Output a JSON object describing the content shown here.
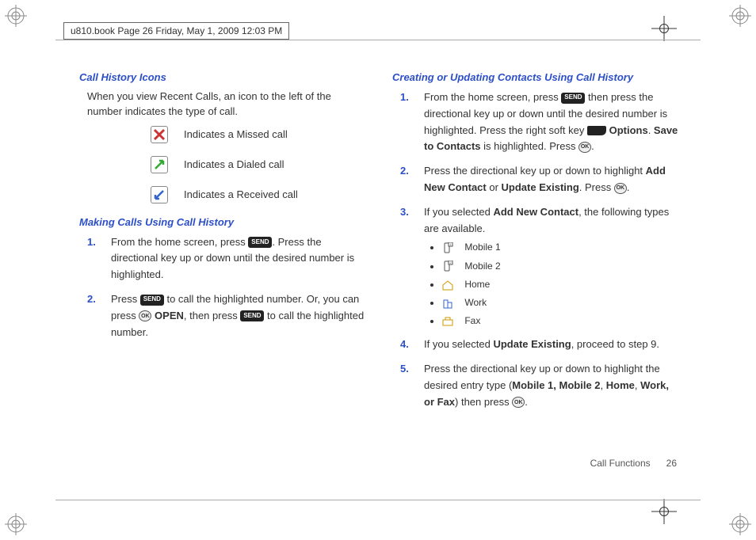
{
  "header": {
    "text": "u810.book  Page 26  Friday, May 1, 2009  12:03 PM"
  },
  "left": {
    "section1": {
      "heading": "Call History Icons",
      "intro": "When you view Recent Calls, an icon to the left of the number indicates the type of call.",
      "missed": "Indicates a Missed call",
      "dialed": "Indicates a Dialed call",
      "received": "Indicates a Received call"
    },
    "section2": {
      "heading": "Making Calls Using Call History",
      "step1a": "From the home screen, press ",
      "step1b": ". Press the directional key up or down until the desired number is highlighted.",
      "step2a": "Press ",
      "step2b": " to call the highlighted number. Or, you can press ",
      "open": "OPEN",
      "step2c": ", then press ",
      "step2d": " to call the highlighted number."
    }
  },
  "right": {
    "section1": {
      "heading": "Creating or Updating Contacts Using Call History",
      "step1a": "From the home screen, press ",
      "step1b": " then press the directional key up or down until the desired number is highlighted. Press the right soft key ",
      "options": "Options",
      "step1c": ". ",
      "saveto": "Save to Contacts",
      "step1d": " is highlighted. Press ",
      "step1e": ".",
      "step2a": "Press the directional key up or down to highlight ",
      "addnew": "Add New Contact",
      "or": " or ",
      "updateex": "Update Existing",
      "step2b": ". Press ",
      "step2c": ".",
      "step3a": "If you selected ",
      "step3b": ", the following types are available.",
      "types": {
        "mobile1": "Mobile 1",
        "mobile2": "Mobile 2",
        "home": "Home",
        "work": "Work",
        "fax": "Fax"
      },
      "step4a": "If you selected ",
      "step4b": ", proceed to step 9.",
      "step5a": "Press the directional key up or down to highlight the desired entry type (",
      "step5types": "Mobile 1, Mobile 2",
      "step5c": ", ",
      "step5home": "Home",
      "step5d": ", ",
      "step5work": "Work, or Fax",
      "step5e": ") then press ",
      "step5f": "."
    }
  },
  "footer": {
    "section": "Call Functions",
    "page": "26"
  },
  "keys": {
    "send": "SEND",
    "ok": "OK"
  }
}
